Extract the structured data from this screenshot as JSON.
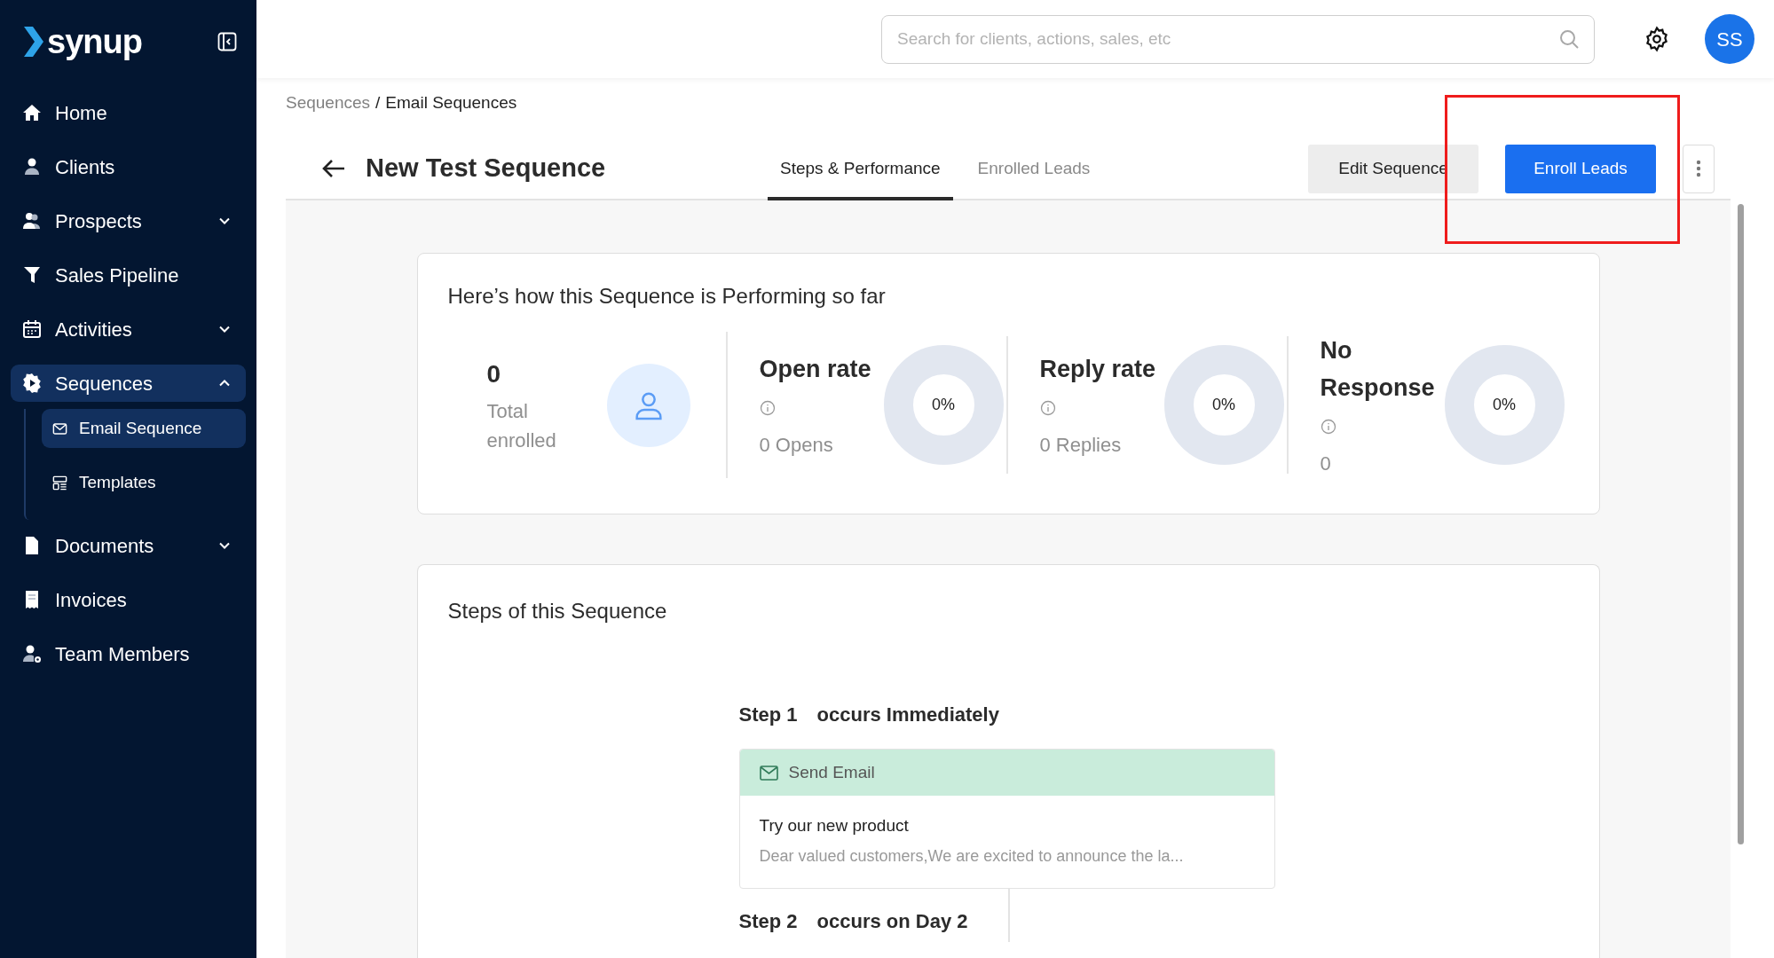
{
  "sidebar": {
    "logo": "synup",
    "items": [
      {
        "label": "Home",
        "selected": false
      },
      {
        "label": "Clients",
        "selected": false
      },
      {
        "label": "Prospects",
        "selected": false,
        "expanded": false
      },
      {
        "label": "Sales Pipeline",
        "selected": false
      },
      {
        "label": "Activities",
        "selected": false,
        "expanded": false
      },
      {
        "label": "Sequences",
        "selected": true,
        "expanded": true,
        "children": [
          {
            "label": "Email Sequence",
            "selected": true
          },
          {
            "label": "Templates",
            "selected": false
          }
        ]
      },
      {
        "label": "Documents",
        "selected": false,
        "expanded": false
      },
      {
        "label": "Invoices",
        "selected": false
      },
      {
        "label": "Team Members",
        "selected": false
      }
    ]
  },
  "header": {
    "search": {
      "placeholder": "Search for clients, actions, sales, etc"
    },
    "avatar": "SS"
  },
  "breadcrumb": {
    "parent": "Sequences",
    "separator": "/",
    "current": "Email Sequences"
  },
  "page": {
    "title": "New Test Sequence",
    "tabs": [
      {
        "label": "Steps & Performance",
        "selected": true
      },
      {
        "label": "Enrolled Leads",
        "selected": false
      }
    ],
    "buttons": [
      {
        "label": "Edit Sequence",
        "kind": "secondary"
      },
      {
        "label": "Enroll Leads",
        "kind": "primary"
      }
    ],
    "highlight": true
  },
  "performance": {
    "title": "Here’s how this Sequence is Performing so far",
    "enrolled": {
      "value": "0",
      "label": "Total enrolled"
    },
    "metrics": [
      {
        "title": "Open rate",
        "sub": "0 Opens",
        "percent": "0%"
      },
      {
        "title": "Reply rate",
        "sub": "0 Replies",
        "percent": "0%"
      },
      {
        "title": "No Response",
        "sub": "0",
        "percent": "0%"
      }
    ]
  },
  "steps": {
    "title": "Steps of this Sequence",
    "items": [
      {
        "label": "Step 1",
        "timing": "occurs Immediately",
        "action": "Send Email",
        "subject": "Try our new product",
        "preview": "Dear valued customers,We are excited to announce the la..."
      },
      {
        "label": "Step 2",
        "timing": "occurs on Day 2"
      }
    ]
  }
}
